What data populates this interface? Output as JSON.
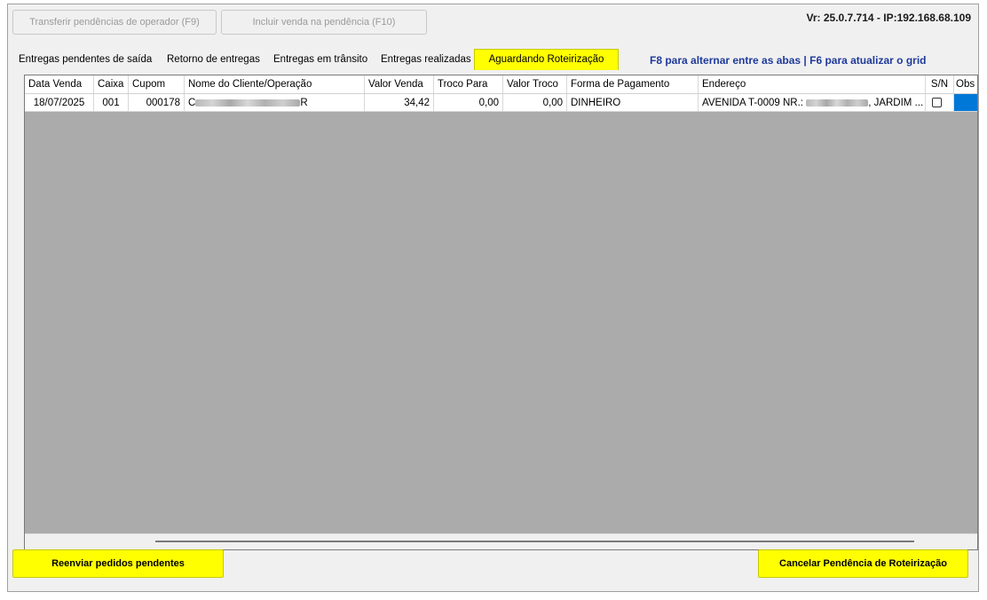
{
  "toolbar": {
    "transfer_label": "Transferir pendências de operador (F9)",
    "include_label": "Incluir venda na pendência (F10)"
  },
  "version": "Vr: 25.0.7.714 - IP:192.168.68.109",
  "tabs": [
    {
      "label": "Entregas pendentes de saída"
    },
    {
      "label": "Retorno de entregas"
    },
    {
      "label": "Entregas em trânsito"
    },
    {
      "label": "Entregas realizadas"
    },
    {
      "label": "Aguardando Roteirização",
      "active": true
    }
  ],
  "hint": "F8 para alternar entre as abas  |  F6 para atualizar o grid",
  "grid": {
    "columns": [
      "Data Venda",
      "Caixa",
      "Cupom",
      "Nome do Cliente/Operação",
      "Valor Venda",
      "Troco Para",
      "Valor Troco",
      "Forma de Pagamento",
      "Endereço",
      "S/N",
      "Obs"
    ],
    "rows": [
      {
        "data_venda": "18/07/2025",
        "caixa": "001",
        "cupom": "000178",
        "nome_prefix": "C",
        "nome_suffix": "R",
        "valor_venda": "34,42",
        "troco_para": "0,00",
        "valor_troco": "0,00",
        "forma_pagamento": "DINHEIRO",
        "endereco_prefix": "AVENIDA T-0009 NR.:",
        "endereco_suffix": ", JARDIM ...",
        "sn_checked": false
      }
    ]
  },
  "footer": {
    "resend_label": "Reenviar pedidos pendentes",
    "cancel_label": "Cancelar Pendência de Roteirização"
  },
  "colors": {
    "highlight": "#ffff00",
    "hint_text": "#1f3a9a",
    "grid_background": "#ababab",
    "selected_cell": "#0078d7"
  }
}
